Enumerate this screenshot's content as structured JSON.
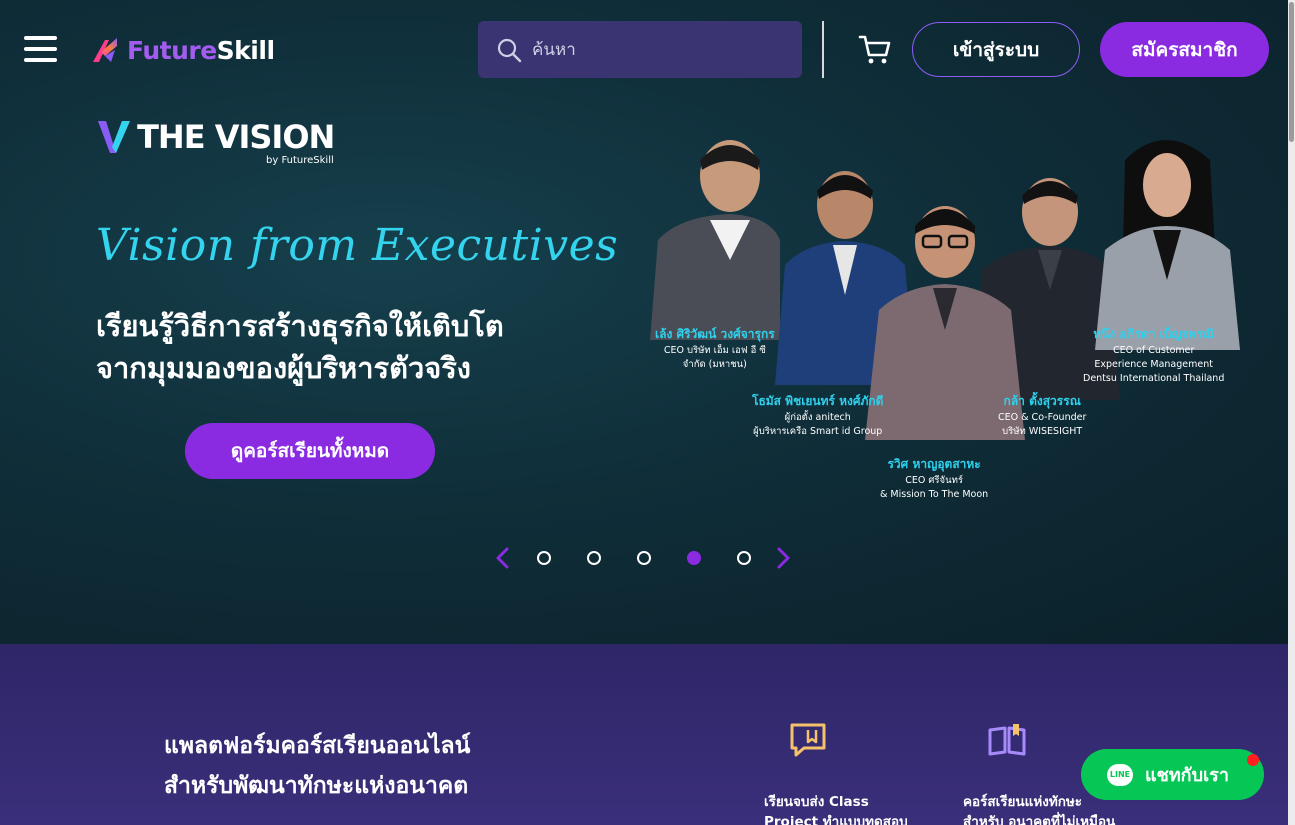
{
  "header": {
    "logo_future": "Future",
    "logo_skill": "Skill",
    "search_placeholder": "ค้นหา",
    "login_label": "เข้าสู่ระบบ",
    "signup_label": "สมัครสมาชิก"
  },
  "hero": {
    "brand_title": "THE VISION",
    "brand_by": "by FutureSkill",
    "tagline": "Vision from Executives",
    "headline_line1": "เรียนรู้วิธีการสร้างธุรกิจให้เติบโต",
    "headline_line2": "จากมุมมองของผู้บริหารตัวจริง",
    "cta_label": "ดูคอร์สเรียนทั้งหมด",
    "executives": [
      {
        "name": "เล้ง ศิริวัฒน์ วงศ์จารุกร",
        "role1": "CEO บริษัท เอ็ม เอฟ อี ซี",
        "role2": "จำกัด (มหาชน)",
        "role3": ""
      },
      {
        "name": "หนึ่ง อภิรดา เบ็ญจพรณี",
        "role1": "CEO of Customer",
        "role2": "Experience Management",
        "role3": "Dentsu International Thailand"
      },
      {
        "name": "โธมัส พิชเยนทร์ หงศ์ภักดี",
        "role1": "ผู้ก่อตั้ง anitech",
        "role2": "ผู้บริหารเครือ Smart id Group",
        "role3": ""
      },
      {
        "name": "กล้า ตั้งสุวรรณ",
        "role1": "CEO & Co-Founder",
        "role2": "บริษัท WISESIGHT",
        "role3": ""
      },
      {
        "name": "รวิศ หาญอุตสาหะ",
        "role1": "CEO ศรีจันทร์",
        "role2": "& Mission To The Moon",
        "role3": ""
      }
    ]
  },
  "carousel": {
    "slide_count": 5,
    "active_index": 3
  },
  "lower": {
    "heading_line1": "แพลตฟอร์มคอร์สเรียนออนไลน์",
    "heading_line2": "สำหรับพัฒนาทักษะแห่งอนาคต",
    "features": [
      {
        "icon": "certificate-flag-icon",
        "line1": "เรียนจบส่ง Class",
        "line2": "Project ทำแบบทดสอบ"
      },
      {
        "icon": "open-book-icon",
        "line1": "คอร์สเรียนแห่งทักษะ",
        "line2": "สำหรับ อนาคตที่ไม่เหมือน"
      }
    ]
  },
  "chat": {
    "label": "แชทกับเรา",
    "line_logo_text": "LINE"
  },
  "colors": {
    "accent_purple": "#8a2be2",
    "tagline_cyan": "#34d4ef",
    "line_green": "#06c755",
    "search_bg": "#3a3572"
  }
}
